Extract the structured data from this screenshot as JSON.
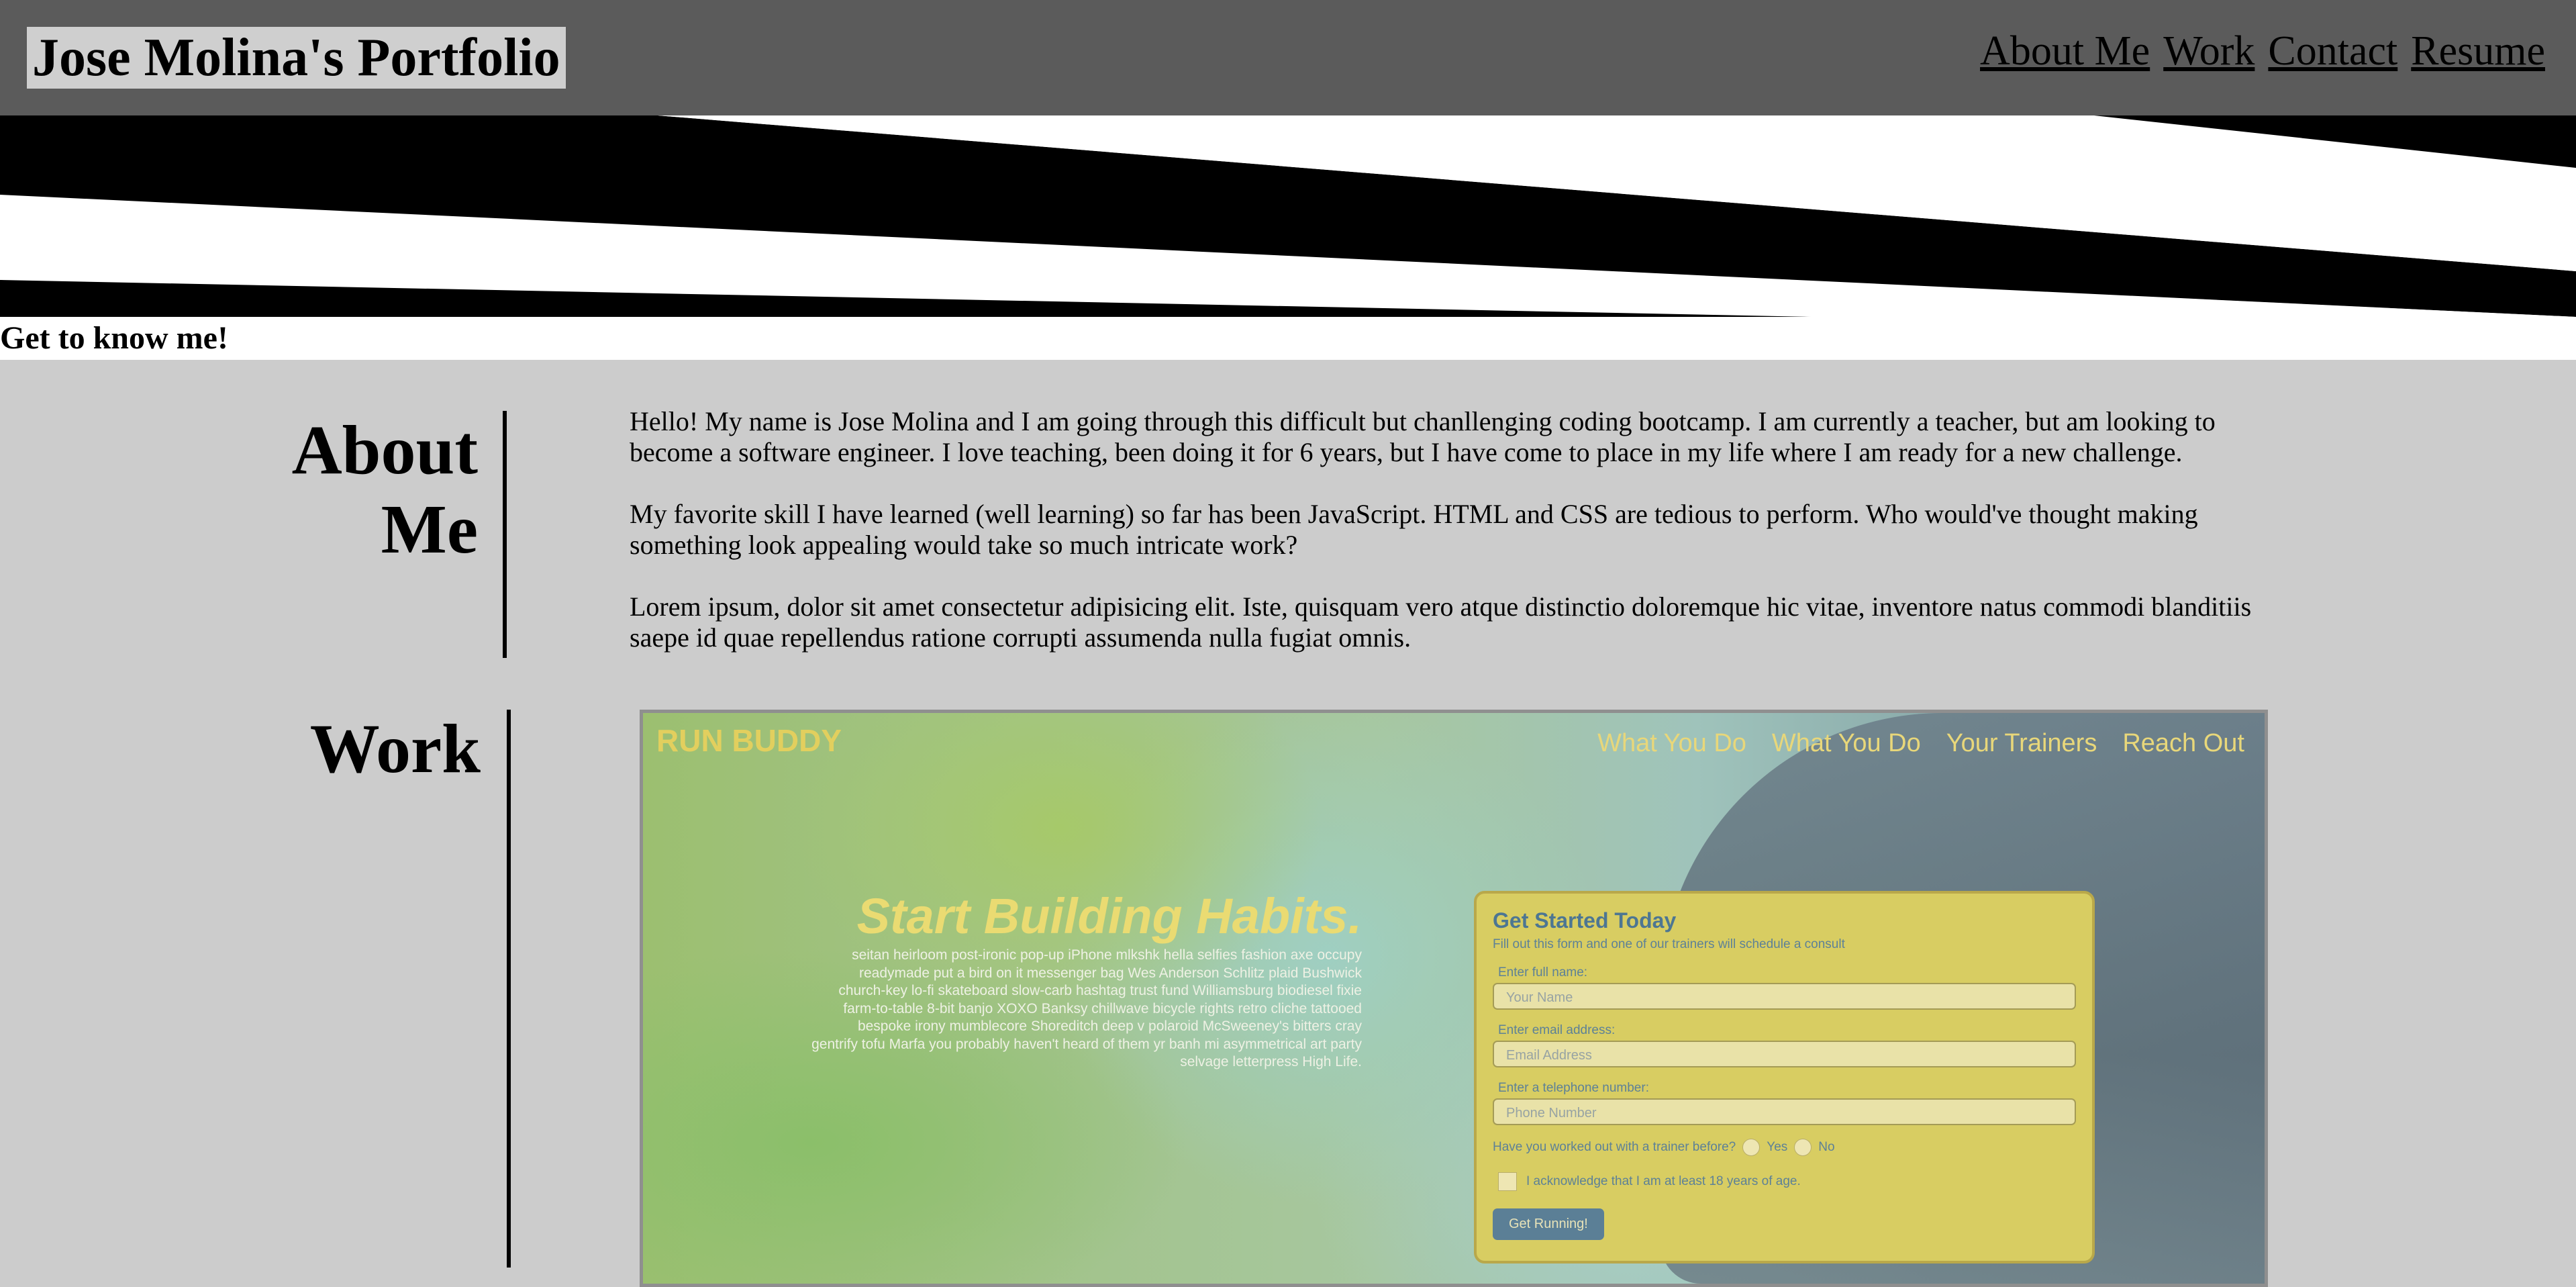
{
  "header": {
    "title": "Jose Molina's Portfolio",
    "nav": [
      "About Me",
      "Work",
      "Contact",
      "Resume"
    ]
  },
  "intro": {
    "heading": "Get to know me!"
  },
  "about": {
    "heading_line1": "About",
    "heading_line2": "Me",
    "paragraphs": [
      "Hello! My name is Jose Molina and I am going through this difficult but chanllenging coding bootcamp. I am currently a teacher, but am looking to become a software engineer. I love teaching, been doing it for 6 years, but I have come to place in my life where I am ready for a new challenge.",
      "My favorite skill I have learned (well learning) so far has been JavaScript. HTML and CSS are tedious to perform. Who would've thought making something look appealing would take so much intricate work?",
      "Lorem ipsum, dolor sit amet consectetur adipisicing elit. Iste, quisquam vero atque distinctio doloremque hic vitae, inventore natus commodi blanditiis saepe id quae repellendus ratione corrupti assumenda nulla fugiat omnis."
    ]
  },
  "work": {
    "heading": "Work",
    "project": {
      "logo": "RUN BUDDY",
      "nav": [
        "What You Do",
        "What You Do",
        "Your Trainers",
        "Reach Out"
      ],
      "hero_title": "Start Building Habits.",
      "hero_text": "seitan heirloom post-ironic pop-up iPhone mlkshk hella selfies fashion axe occupy readymade put a bird on it messenger bag Wes Anderson Schlitz plaid Bushwick church-key lo-fi skateboard slow-carb hashtag trust fund Williamsburg biodiesel fixie farm-to-table 8-bit banjo XOXO Banksy chillwave bicycle rights retro cliche tattooed bespoke irony mumblecore Shoreditch deep v polaroid McSweeney's bitters cray gentrify tofu Marfa you probably haven't heard of them yr banh mi asymmetrical art party selvage letterpress High Life.",
      "form": {
        "title": "Get Started Today",
        "subtitle": "Fill out this form and one of our trainers will schedule a consult",
        "name_label": "Enter full name:",
        "name_placeholder": "Your Name",
        "email_label": "Enter email address:",
        "email_placeholder": "Email Address",
        "phone_label": "Enter a telephone number:",
        "phone_placeholder": "Phone Number",
        "trainer_question": "Have you worked out with a trainer before?",
        "yes": "Yes",
        "no": "No",
        "age_ack": "I acknowledge that I am at least 18 years of age.",
        "submit": "Get Running!"
      }
    }
  }
}
